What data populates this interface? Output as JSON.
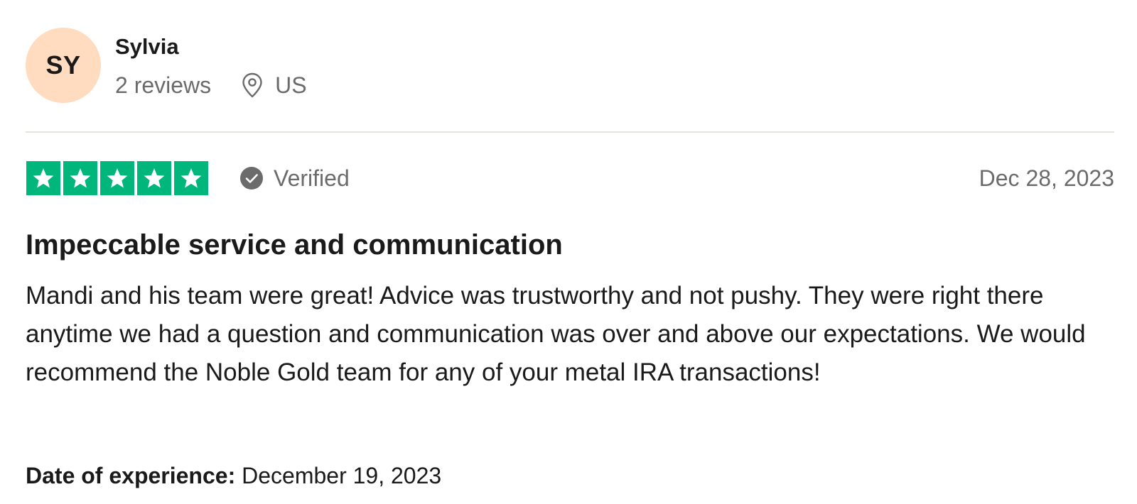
{
  "reviewer": {
    "initials": "SY",
    "avatar_color": "#ffdbbf",
    "name": "Sylvia",
    "review_count": "2 reviews",
    "location_icon": "location-pin-icon",
    "country": "US"
  },
  "review": {
    "rating": 5,
    "max_rating": 5,
    "star_color": "#00b67a",
    "verified_icon": "check-circle-icon",
    "verified_label": "Verified",
    "date": "Dec 28, 2023",
    "title": "Impeccable service and communication",
    "body": "Mandi and his team were great! Advice was trustworthy and not pushy. They were right there anytime we had a question and communication was over and above our expectations. We would recommend the Noble Gold team for any of your metal IRA transactions!",
    "experience_label": "Date of experience:",
    "experience_date": "December 19, 2023"
  }
}
